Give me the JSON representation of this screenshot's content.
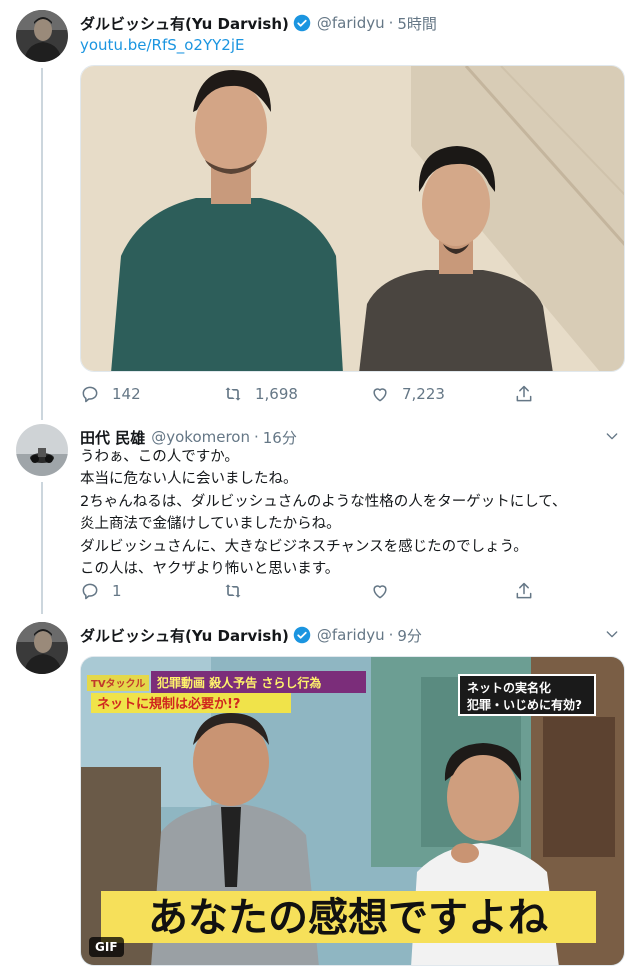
{
  "colors": {
    "accent": "#1b95e0",
    "secondary_text": "#657786",
    "thread_line": "#ccd6dd"
  },
  "tweets": [
    {
      "display_name": "ダルビッシュ有(Yu Darvish)",
      "verified": true,
      "handle": "@faridyu",
      "separator": "·",
      "time": "5時間",
      "link": "youtu.be/RfS_o2YY2jE",
      "actions": {
        "reply": "142",
        "retweet": "1,698",
        "like": "7,223"
      }
    },
    {
      "display_name": "田代 民雄",
      "handle": "@yokomeron",
      "separator": "·",
      "time": "16分",
      "lines": [
        "うわぁ、この人ですか。",
        "本当に危ない人に会いましたね。",
        "2ちゃんねるは、ダルビッシュさんのような性格の人をターゲットにして、",
        "炎上商法で金儲けしていましたからね。",
        "ダルビッシュさんに、大きなビジネスチャンスを感じたのでしょう。",
        "この人は、ヤクザより怖いと思います。"
      ],
      "actions": {
        "reply": "1",
        "retweet": "",
        "like": ""
      }
    },
    {
      "display_name": "ダルビッシュ有(Yu Darvish)",
      "verified": true,
      "handle": "@faridyu",
      "separator": "·",
      "time": "9分",
      "gif_label": "GIF",
      "tv": {
        "corner_title": "TVタックル",
        "banner_top": "犯罪動画 殺人予告 さらし行為",
        "banner_bottom": "ネットに規制は必要か!?",
        "topic_line1": "ネットの実名化",
        "topic_line2": "犯罪・いじめに有効?",
        "subtitle": "あなたの感想ですよね"
      }
    }
  ]
}
